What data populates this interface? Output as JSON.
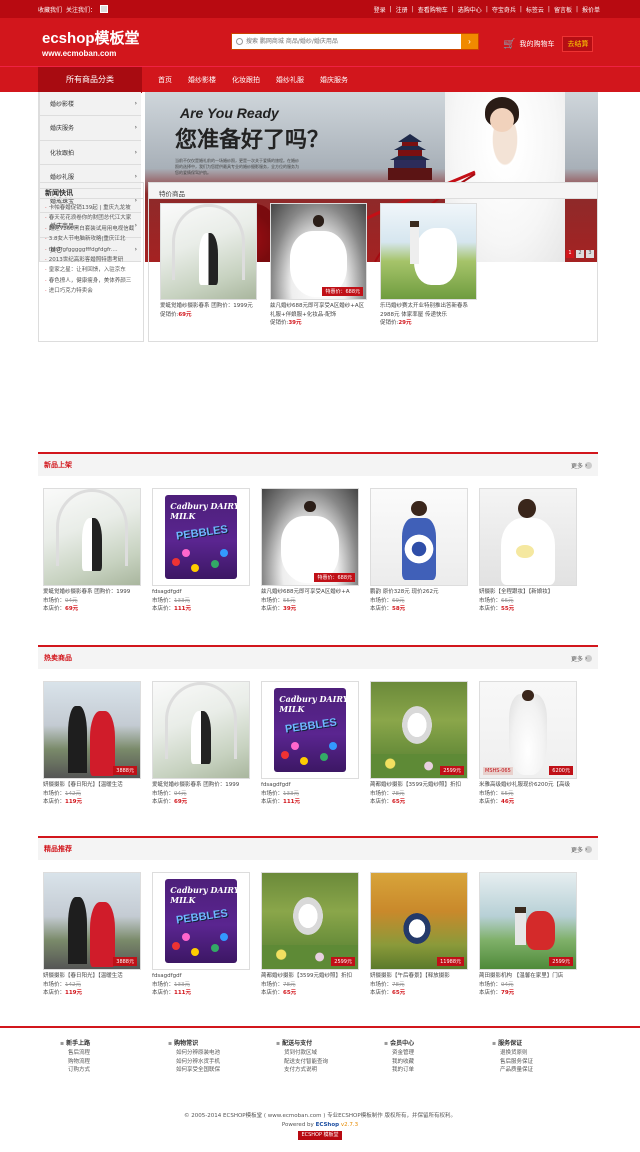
{
  "topbar": {
    "left": [
      "收藏我们",
      "关注我们：",
      "QR"
    ],
    "right": [
      "登录",
      "|",
      "注册",
      "|",
      "查看购物车",
      "|",
      "选购中心",
      "|",
      "夺宝奇兵",
      "|",
      "标签云",
      "|",
      "留言板",
      "|",
      "报价单"
    ]
  },
  "header": {
    "logo": "ecshop模板堂",
    "logo_url": "www.ecmoban.com",
    "search_placeholder": "搜索 鹏网商城 商品/婚纱/婚庆用品",
    "search_button": "›",
    "cart_icon": "cart-icon",
    "cart_label": "我的购物车",
    "checkout": "去结算"
  },
  "nav": {
    "all": "所有商品分类",
    "items": [
      "首页",
      "婚纱影楼",
      "化妆跟拍",
      "婚纱礼服",
      "婚庆服务"
    ]
  },
  "categories": [
    "婚纱影楼",
    "婚庆服务",
    "化妆跟拍",
    "婚纱礼服",
    "婚戒珠宝",
    "婚庆商品",
    "其它"
  ],
  "banner": {
    "t1": "Are You Ready",
    "t2": "您准备好了吗？",
    "desc": "当前不仅仅是婚礼前的一场婚纱照，更是一次关于爱情的旅程。在婚纱照的选择中，我们为您提供最具专业的婚纱摄影服务，全方位的服务为您的爱情保驾护航。",
    "dots": [
      "1",
      "2",
      "3"
    ]
  },
  "news": {
    "title": "新闻快讯",
    "items": [
      "卡帕春婚促销139起 | 重庆九龙坡",
      "春天花花浪卷你的财团总代江大家",
      "翻莲7260黑白套装试用用电视信截",
      "3.8女人节电脑新攻略|重庆江北",
      "fgsdfgfgggggfffdgfdgfr....",
      "2013世纪高彩客婚照特惠考研",
      "皇家之星：让利回馈，入驻京东",
      "春色撩人，健康瘦身，美体养颜三",
      "进口巧克力特卖会"
    ]
  },
  "special": {
    "title": "特价商品",
    "items": [
      {
        "name": "爱蜓觉婚纱摄影春系 团购价：1999元",
        "promo_label": "促销价:",
        "price": "69元",
        "photo": "church"
      },
      {
        "name": "兹凡婚纱688元即可享受A区婚纱+A区礼服+伴娘服+化妆品-配饰",
        "promo_label": "促销价:",
        "price": "39元",
        "badge": "特惠价：688元",
        "photo": "dress"
      },
      {
        "name": "乐玛婚纱赛太开业特别推出答新春系2988元 体家率屋 传递快乐",
        "promo_label": "促销价:",
        "price": "29元",
        "photo": "field"
      }
    ]
  },
  "more_label": "更多",
  "sections": [
    {
      "title": "新品上架",
      "items": [
        {
          "name": "爱蜓觉婚纱摄影春系 团购价：1999",
          "market_label": "市场价：",
          "market": "94元",
          "shop_label": "本店价：",
          "shop": "69元",
          "photo": "church"
        },
        {
          "name": "fdsagdfgdf",
          "market_label": "市场价：",
          "market": "133元",
          "shop_label": "本店价：",
          "shop": "111元",
          "photo": "choc"
        },
        {
          "name": "兹凡婚纱688元即可享受A区婚纱+A",
          "market_label": "市场价：",
          "market": "55元",
          "shop_label": "本店价：",
          "shop": "39元",
          "badge": "特惠价：688元",
          "photo": "dress"
        },
        {
          "name": "鹏韵 原价328元 现价262元",
          "market_label": "市场价：",
          "market": "69元",
          "shop_label": "本店价：",
          "shop": "58元",
          "photo": "qipao"
        },
        {
          "name": "妍摄影【全程跟妆】【新娘妆】",
          "market_label": "市场价：",
          "market": "66元",
          "shop_label": "本店价：",
          "shop": "55元",
          "photo": "bouq"
        }
      ]
    },
    {
      "title": "热卖商品",
      "items": [
        {
          "name": "妍摄摄影【春日阳光】【温暖生活",
          "market_label": "市场价：",
          "market": "142元",
          "shop_label": "本店价：",
          "shop": "119元",
          "badge": "3888元",
          "photo": "red"
        },
        {
          "name": "爱蜓觉婚纱摄影春系 团购价：1999",
          "market_label": "市场价：",
          "market": "94元",
          "shop_label": "本店价：",
          "shop": "69元",
          "photo": "church"
        },
        {
          "name": "fdsagdfgdf",
          "market_label": "市场价：",
          "market": "133元",
          "shop_label": "本店价：",
          "shop": "111元",
          "photo": "choc"
        },
        {
          "name": "蔺都婚纱摄影【3599元婚纱照】折扣",
          "market_label": "市场价：",
          "market": "78元",
          "shop_label": "本店价：",
          "shop": "65元",
          "badge": "2599元",
          "photo": "garden"
        },
        {
          "name": "米雅高级婚纱礼服现价6200元【高级",
          "market_label": "市场价：",
          "market": "55元",
          "shop_label": "本店价：",
          "shop": "46元",
          "badge": "6200元",
          "tag": "MSHS-065",
          "photo": "wed"
        }
      ]
    },
    {
      "title": "精品推荐",
      "items": [
        {
          "name": "妍摄摄影【春日阳光】【温暖生活",
          "market_label": "市场价：",
          "market": "142元",
          "shop_label": "本店价：",
          "shop": "119元",
          "badge": "3888元",
          "photo": "red"
        },
        {
          "name": "fdsagdfgdf",
          "market_label": "市场价：",
          "market": "133元",
          "shop_label": "本店价：",
          "shop": "111元",
          "photo": "choc"
        },
        {
          "name": "蔺都婚纱摄影【3599元婚纱照】折扣",
          "market_label": "市场价：",
          "market": "78元",
          "shop_label": "本店价：",
          "shop": "65元",
          "badge": "2599元",
          "photo": "garden"
        },
        {
          "name": "妍摄摄影【午后春景】【释放摄影",
          "market_label": "市场价：",
          "market": "78元",
          "shop_label": "本店价：",
          "shop": "65元",
          "badge": "11988元",
          "photo": "autumn"
        },
        {
          "name": "蔺田摄影机构 【温馨在家里】门店",
          "market_label": "市场价：",
          "market": "94元",
          "shop_label": "本店价：",
          "shop": "79元",
          "badge": "2599元",
          "photo": "lake"
        }
      ]
    }
  ],
  "footer": {
    "cols": [
      {
        "title": "新手上路",
        "links": [
          "售后流程",
          "购物流程",
          "订购方式"
        ]
      },
      {
        "title": "购物常识",
        "links": [
          "如何分辨原装电池",
          "如何分辨水货手机",
          "如何享受全国联保"
        ]
      },
      {
        "title": "配送与支付",
        "links": [
          "货到付款区域",
          "配送支付智能查询",
          "支付方式说明"
        ]
      },
      {
        "title": "会员中心",
        "links": [
          "资金管理",
          "我的收藏",
          "我的订单"
        ]
      },
      {
        "title": "服务保证",
        "links": [
          "退换货原则",
          "售后服务保证",
          "产品质量保证"
        ]
      }
    ],
    "copyright": "© 2005-2014 ECSHOP模板堂 ( www.ecmoban.com ) 专业ECSHOP模板制作 版权所有，并保留所有权利。",
    "powered": "Powered by",
    "ecshop": "ECShop",
    "version": "v2.7.3",
    "badge": "ECSHOP 模板堂"
  }
}
